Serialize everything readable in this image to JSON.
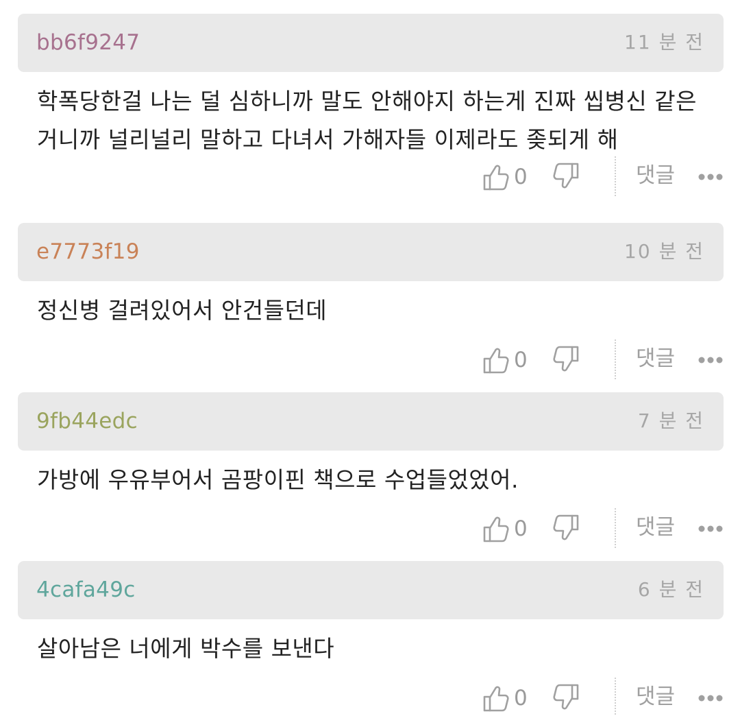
{
  "comments": [
    {
      "username": "bb6f9247",
      "username_color": "#a7718e",
      "time": "11 분 전",
      "text": "학폭당한걸 나는 덜 심하니까 말도 안해야지 하는게 진짜 씹병신 같은 거니까 널리널리 말하고 다녀서 가해자들 이제라도 좆되게 해",
      "likes": "0",
      "reply_label": "댓글"
    },
    {
      "username": "e7773f19",
      "username_color": "#c98257",
      "time": "10 분 전",
      "text": "정신병 걸려있어서 안건들던데",
      "likes": "0",
      "reply_label": "댓글"
    },
    {
      "username": "9fb44edc",
      "username_color": "#9aa45e",
      "time": "7 분 전",
      "text": "가방에 우유부어서 곰팡이핀 책으로 수업들었었어.",
      "likes": "0",
      "reply_label": "댓글"
    },
    {
      "username": "4cafa49c",
      "username_color": "#5fa69c",
      "time": "6 분 전",
      "text": "살아남은 너에게 박수를 보낸다",
      "likes": "0",
      "reply_label": "댓글"
    }
  ],
  "icons": {
    "like": "thumbs-up-icon",
    "dislike": "thumbs-down-icon",
    "more": "more-dots-icon"
  },
  "colors": {
    "header_bg": "#e9e9e9",
    "meta_text": "#a6a6a6",
    "body_text": "#222222",
    "icon_gray": "#a0a0a0"
  }
}
